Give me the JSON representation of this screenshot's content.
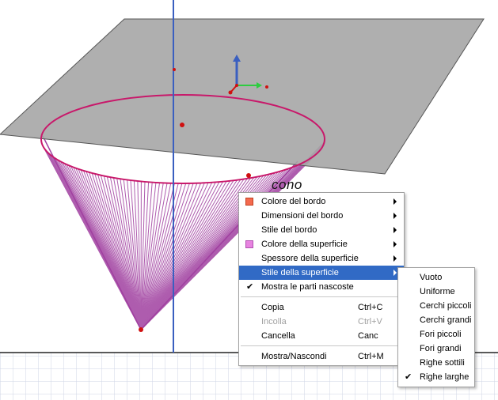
{
  "object_label": "cono",
  "context_menu": {
    "items": [
      {
        "label": "Colore del bordo",
        "swatch": "#f46a4e",
        "submenu": true
      },
      {
        "label": "Dimensioni del bordo",
        "submenu": true
      },
      {
        "label": "Stile del bordo",
        "submenu": true
      },
      {
        "label": "Colore della superficie",
        "swatch": "#e783e0",
        "submenu": true
      },
      {
        "label": "Spessore della superficie",
        "submenu": true
      },
      {
        "label": "Stile della superficie",
        "submenu": true,
        "selected": true
      },
      {
        "label": "Mostra le parti nascoste",
        "checked": true
      }
    ],
    "edit": [
      {
        "label": "Copia",
        "shortcut": "Ctrl+C"
      },
      {
        "label": "Incolla",
        "shortcut": "Ctrl+V",
        "disabled": true
      },
      {
        "label": "Cancella",
        "shortcut": "Canc"
      }
    ],
    "visibility": {
      "label": "Mostra/Nascondi",
      "shortcut": "Ctrl+M"
    }
  },
  "surface_style_submenu": {
    "items": [
      "Vuoto",
      "Uniforme",
      "Cerchi piccoli",
      "Cerchi grandi",
      "Fori piccoli",
      "Fori grandi",
      "Righe sottili",
      "Righe larghe"
    ],
    "checked": "Righe larghe"
  },
  "colors": {
    "plane": "#a6a6a6",
    "ellipse": "#c8186a",
    "cone": "#a040a0",
    "axis": "#3a5fc0",
    "points": "#d01010",
    "menu_highlight": "#316ac5"
  }
}
